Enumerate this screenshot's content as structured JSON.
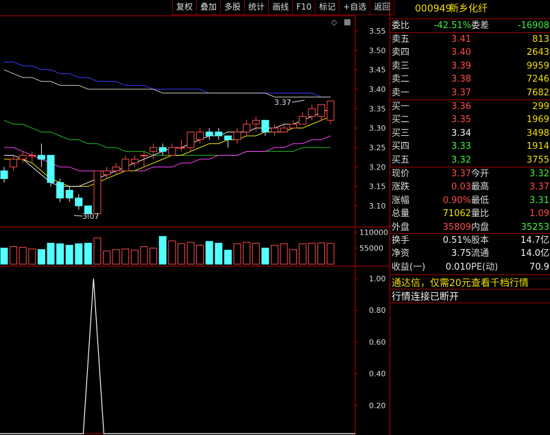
{
  "toolbar": [
    "复权",
    "叠加",
    "多股",
    "统计",
    "画线",
    "F10",
    "标记",
    "+自选",
    "返回"
  ],
  "stock": {
    "code": "000949",
    "name": "新乡化纤"
  },
  "wei": {
    "wb_label": "委比",
    "wb_value": "-42.51%",
    "wc_label": "委差",
    "wc_value": "-16908"
  },
  "asks": [
    {
      "label": "卖五",
      "price": "3.41",
      "vol": "813"
    },
    {
      "label": "卖四",
      "price": "3.40",
      "vol": "2643"
    },
    {
      "label": "卖三",
      "price": "3.39",
      "vol": "9959"
    },
    {
      "label": "卖二",
      "price": "3.38",
      "vol": "7246"
    },
    {
      "label": "卖一",
      "price": "3.37",
      "vol": "7682"
    }
  ],
  "bids": [
    {
      "label": "买一",
      "price": "3.36",
      "vol": "299"
    },
    {
      "label": "买二",
      "price": "3.35",
      "vol": "1969"
    },
    {
      "label": "买三",
      "price": "3.34",
      "vol": "3498"
    },
    {
      "label": "买四",
      "price": "3.33",
      "vol": "1914"
    },
    {
      "label": "买五",
      "price": "3.32",
      "vol": "3755"
    }
  ],
  "quote": [
    {
      "l1": "现价",
      "v1": "3.37",
      "l2": "今开",
      "v2": "3.32"
    },
    {
      "l1": "涨跌",
      "v1": "0.03",
      "l2": "最高",
      "v2": "3.37"
    },
    {
      "l1": "涨幅",
      "v1": "0.90%",
      "l2": "最低",
      "v2": "3.31"
    },
    {
      "l1": "总量",
      "v1": "71062",
      "l2": "量比",
      "v2": "1.09"
    },
    {
      "l1": "外盘",
      "v1": "35809",
      "l2": "内盘",
      "v2": "35253"
    }
  ],
  "fin": [
    {
      "l1": "换手",
      "v1": "0.51%",
      "l2": "股本",
      "v2": "14.7亿"
    },
    {
      "l1": "净资",
      "v1": "3.75",
      "l2": "流通",
      "v2": "14.0亿"
    },
    {
      "l1": "收益(一)",
      "v1": "0.010",
      "l2": "PE(动)",
      "v2": "70.9"
    }
  ],
  "messages": {
    "promo": "通达信，仅需20元查看千档行情",
    "status": "行情连接已断开"
  },
  "price_axis": [
    "3.55",
    "3.50",
    "3.45",
    "3.40",
    "3.35",
    "3.30",
    "3.25",
    "3.20",
    "3.15",
    "3.10"
  ],
  "vol_axis": [
    "110000",
    "55000"
  ],
  "ind_axis": [
    "1.00",
    "0.80",
    "0.60",
    "0.40",
    "0.20"
  ],
  "annotations": {
    "high": "3.37",
    "low": "3.07"
  },
  "colors": {
    "up": "#ff4b4b",
    "down": "#54ffff",
    "frame": "#c00000"
  },
  "chart_data": {
    "type": "candlestick",
    "ylim": [
      3.05,
      3.56
    ],
    "candles": [
      [
        3.19,
        3.17,
        3.2,
        3.16
      ],
      [
        3.2,
        3.22,
        3.23,
        3.19
      ],
      [
        3.22,
        3.23,
        3.24,
        3.21
      ],
      [
        3.23,
        3.23,
        3.24,
        3.21
      ],
      [
        3.23,
        3.22,
        3.26,
        3.2
      ],
      [
        3.23,
        3.16,
        3.23,
        3.15
      ],
      [
        3.16,
        3.12,
        3.17,
        3.11
      ],
      [
        3.14,
        3.12,
        3.15,
        3.11
      ],
      [
        3.12,
        3.1,
        3.13,
        3.09
      ],
      [
        3.1,
        3.08,
        3.1,
        3.07
      ],
      [
        3.08,
        3.19,
        3.19,
        3.07
      ],
      [
        3.18,
        3.19,
        3.2,
        3.17
      ],
      [
        3.19,
        3.2,
        3.21,
        3.18
      ],
      [
        3.19,
        3.22,
        3.23,
        3.19
      ],
      [
        3.21,
        3.22,
        3.23,
        3.2
      ],
      [
        3.23,
        3.23,
        3.24,
        3.2
      ],
      [
        3.24,
        3.25,
        3.26,
        3.22
      ],
      [
        3.25,
        3.24,
        3.26,
        3.23
      ],
      [
        3.23,
        3.25,
        3.26,
        3.23
      ],
      [
        3.25,
        3.25,
        3.27,
        3.24
      ],
      [
        3.25,
        3.29,
        3.29,
        3.24
      ],
      [
        3.27,
        3.29,
        3.3,
        3.26
      ],
      [
        3.29,
        3.28,
        3.3,
        3.27
      ],
      [
        3.29,
        3.28,
        3.3,
        3.27
      ],
      [
        3.28,
        3.27,
        3.28,
        3.25
      ],
      [
        3.27,
        3.29,
        3.3,
        3.26
      ],
      [
        3.29,
        3.31,
        3.32,
        3.28
      ],
      [
        3.31,
        3.32,
        3.33,
        3.29
      ],
      [
        3.32,
        3.29,
        3.32,
        3.28
      ],
      [
        3.29,
        3.3,
        3.31,
        3.28
      ],
      [
        3.29,
        3.3,
        3.31,
        3.29
      ],
      [
        3.3,
        3.31,
        3.32,
        3.3
      ],
      [
        3.31,
        3.33,
        3.34,
        3.31
      ],
      [
        3.33,
        3.35,
        3.36,
        3.32
      ],
      [
        3.33,
        3.36,
        3.36,
        3.32
      ],
      [
        3.32,
        3.37,
        3.37,
        3.31
      ]
    ],
    "ma_white": [
      3.23,
      3.23,
      3.22,
      3.2,
      3.18,
      3.16,
      3.15,
      3.15,
      3.15,
      3.16,
      3.17,
      3.18,
      3.19,
      3.2,
      3.21,
      3.22,
      3.23,
      3.24,
      3.25,
      3.25,
      3.26,
      3.27,
      3.28,
      3.28,
      3.29,
      3.29,
      3.29,
      3.3,
      3.3,
      3.3,
      3.31,
      3.31,
      3.32,
      3.33,
      3.34,
      3.35
    ],
    "ma_yellow": [
      3.22,
      3.22,
      3.22,
      3.21,
      3.19,
      3.17,
      3.16,
      3.15,
      3.15,
      3.15,
      3.16,
      3.17,
      3.18,
      3.19,
      3.19,
      3.2,
      3.21,
      3.22,
      3.23,
      3.23,
      3.24,
      3.25,
      3.26,
      3.26,
      3.27,
      3.27,
      3.28,
      3.28,
      3.29,
      3.29,
      3.29,
      3.3,
      3.3,
      3.31,
      3.32,
      3.33
    ],
    "ma_magenta": [
      3.25,
      3.25,
      3.24,
      3.23,
      3.22,
      3.21,
      3.2,
      3.2,
      3.19,
      3.19,
      3.19,
      3.19,
      3.19,
      3.19,
      3.19,
      3.19,
      3.2,
      3.2,
      3.2,
      3.21,
      3.21,
      3.22,
      3.22,
      3.23,
      3.23,
      3.23,
      3.24,
      3.24,
      3.24,
      3.25,
      3.25,
      3.26,
      3.26,
      3.27,
      3.27,
      3.28
    ],
    "ma_green": [
      3.32,
      3.31,
      3.31,
      3.3,
      3.29,
      3.29,
      3.28,
      3.27,
      3.27,
      3.26,
      3.26,
      3.25,
      3.25,
      3.24,
      3.24,
      3.24,
      3.23,
      3.23,
      3.23,
      3.23,
      3.23,
      3.23,
      3.23,
      3.23,
      3.23,
      3.23,
      3.24,
      3.24,
      3.24,
      3.24,
      3.24,
      3.24,
      3.25,
      3.25,
      3.25,
      3.25
    ],
    "ma_white_long": [
      3.45,
      3.44,
      3.43,
      3.43,
      3.42,
      3.42,
      3.41,
      3.41,
      3.41,
      3.4,
      3.4,
      3.4,
      3.4,
      3.4,
      3.4,
      3.4,
      3.4,
      3.39,
      3.39,
      3.39,
      3.39,
      3.39,
      3.39,
      3.39,
      3.39,
      3.39,
      3.39,
      3.39,
      3.39,
      3.38,
      3.38,
      3.38,
      3.38,
      3.38,
      3.38,
      3.38
    ],
    "ma_blue": [
      3.47,
      3.47,
      3.46,
      3.46,
      3.45,
      3.45,
      3.44,
      3.44,
      3.43,
      3.43,
      3.42,
      3.42,
      3.42,
      3.41,
      3.41,
      3.41,
      3.4,
      3.4,
      3.4,
      3.4,
      3.4,
      3.4,
      3.39,
      3.39,
      3.39,
      3.39,
      3.39,
      3.39,
      3.39,
      3.39,
      3.39,
      3.39,
      3.39,
      3.39,
      3.38,
      3.38
    ],
    "volume": [
      55000,
      60000,
      58000,
      52000,
      50000,
      72000,
      70000,
      65000,
      70000,
      72000,
      90000,
      45000,
      50000,
      52000,
      48000,
      60000,
      55000,
      95000,
      80000,
      70000,
      75000,
      65000,
      78000,
      72000,
      48000,
      70000,
      75000,
      72000,
      55000,
      65000,
      70000,
      50000,
      70000,
      72000,
      73000,
      71000
    ],
    "vol_ylim": [
      0,
      120000
    ],
    "indicator": {
      "ylim": [
        0,
        1
      ],
      "spike_index": 9,
      "values": [
        0,
        0,
        0,
        0,
        0,
        0,
        0,
        0,
        0,
        1,
        0,
        0,
        0,
        0,
        0,
        0,
        0,
        0,
        0,
        0,
        0,
        0,
        0,
        0,
        0,
        0,
        0,
        0,
        0,
        0,
        0,
        0,
        0,
        0,
        0,
        0
      ]
    }
  }
}
